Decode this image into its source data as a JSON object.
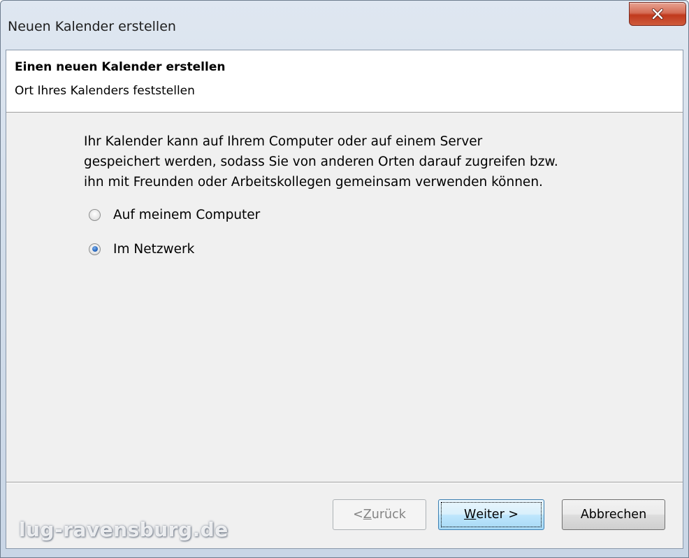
{
  "window": {
    "title": "Neuen Kalender erstellen",
    "close_label": "X"
  },
  "header": {
    "title": "Einen neuen Kalender erstellen",
    "subtitle": "Ort Ihres Kalenders feststellen"
  },
  "description": {
    "lines": [
      "Ihr Kalender kann auf Ihrem Computer oder auf einem Server",
      "gespeichert werden, sodass Sie von anderen Orten darauf zugreifen bzw.",
      "ihn mit Freunden oder Arbeitskollegen gemeinsam verwenden können."
    ]
  },
  "options": [
    {
      "label": "Auf meinem Computer",
      "checked": false
    },
    {
      "label": "Im Netzwerk",
      "checked": true
    }
  ],
  "buttons": {
    "back": {
      "prefix": "< ",
      "mnemonic": "Z",
      "rest": "urück",
      "enabled": false
    },
    "next": {
      "mnemonic": "W",
      "rest": "eiter >",
      "default": true
    },
    "cancel": {
      "label": "Abbrechen"
    }
  },
  "watermark": "lug-ravensburg.de",
  "colors": {
    "accent": "#3c7fb1",
    "close_red": "#c0391d",
    "dialog_bg": "#f0f0f0"
  }
}
